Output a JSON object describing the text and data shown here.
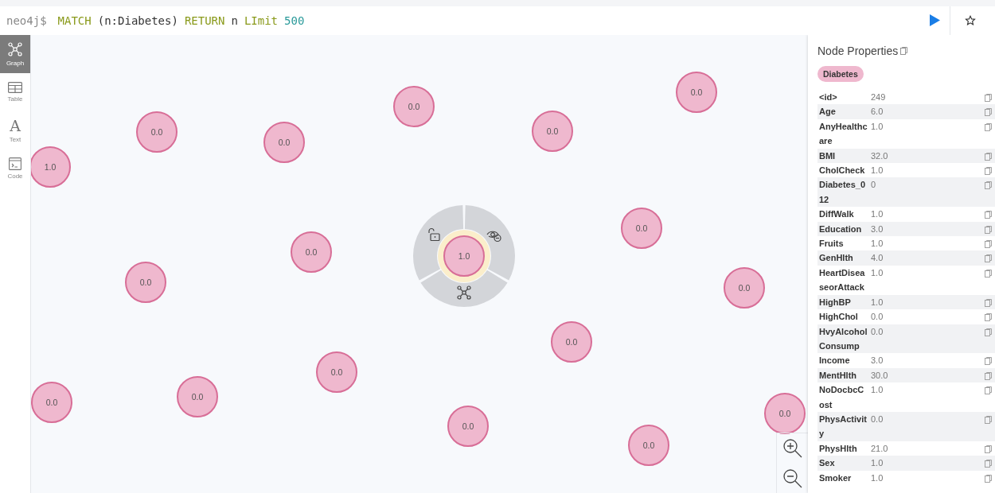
{
  "query": {
    "prompt": "neo4j$",
    "tokens": [
      {
        "text": "MATCH",
        "kind": "keyword"
      },
      {
        "text": "(n:Diabetes)",
        "kind": "plain"
      },
      {
        "text": "RETURN",
        "kind": "keyword"
      },
      {
        "text": "n",
        "kind": "plain"
      },
      {
        "text": "LImit",
        "kind": "keyword"
      },
      {
        "text": "500",
        "kind": "number"
      }
    ]
  },
  "sidebar": {
    "items": [
      {
        "label": "Graph",
        "kind": "graph",
        "selected": true
      },
      {
        "label": "Table",
        "kind": "table",
        "selected": false
      },
      {
        "label": "Text",
        "kind": "text",
        "glyph": "A",
        "selected": false
      },
      {
        "label": "Code",
        "kind": "code",
        "selected": false
      }
    ]
  },
  "graph": {
    "nodes": [
      {
        "caption": "1.0",
        "selected": false
      },
      {
        "caption": "0.0",
        "selected": false
      },
      {
        "caption": "0.0",
        "selected": false
      },
      {
        "caption": "0.0",
        "selected": false
      },
      {
        "caption": "0.0",
        "selected": false
      },
      {
        "caption": "0.0",
        "selected": false
      },
      {
        "caption": "0.0",
        "selected": false
      },
      {
        "caption": "0.0",
        "selected": false
      },
      {
        "caption": "0.0",
        "selected": false
      },
      {
        "caption": "1.0",
        "selected": true
      },
      {
        "caption": "0.0",
        "selected": false
      },
      {
        "caption": "0.0",
        "selected": false
      },
      {
        "caption": "0.0",
        "selected": false
      },
      {
        "caption": "0.0",
        "selected": false
      },
      {
        "caption": "0.0",
        "selected": false
      },
      {
        "caption": "0.0",
        "selected": false
      },
      {
        "caption": "0.0",
        "selected": false
      },
      {
        "caption": "0.0",
        "selected": false
      }
    ]
  },
  "node_properties": {
    "title": "Node Properties",
    "labels": [
      "Diabetes"
    ],
    "properties": [
      {
        "key": "<id>",
        "value": "249"
      },
      {
        "key": "Age",
        "value": "6.0"
      },
      {
        "key": "AnyHealthcare",
        "value": "1.0"
      },
      {
        "key": "BMI",
        "value": "32.0"
      },
      {
        "key": "CholCheck",
        "value": "1.0"
      },
      {
        "key": "Diabetes_012",
        "value": "0"
      },
      {
        "key": "DiffWalk",
        "value": "1.0"
      },
      {
        "key": "Education",
        "value": "3.0"
      },
      {
        "key": "Fruits",
        "value": "1.0"
      },
      {
        "key": "GenHlth",
        "value": "4.0"
      },
      {
        "key": "HeartDiseaseorAttack",
        "value": "1.0"
      },
      {
        "key": "HighBP",
        "value": "1.0"
      },
      {
        "key": "HighChol",
        "value": "0.0"
      },
      {
        "key": "HvyAlcoholConsump",
        "value": "0.0"
      },
      {
        "key": "Income",
        "value": "3.0"
      },
      {
        "key": "MentHlth",
        "value": "30.0"
      },
      {
        "key": "NoDocbcCost",
        "value": "1.0"
      },
      {
        "key": "PhysActivity",
        "value": "0.0"
      },
      {
        "key": "PhysHlth",
        "value": "21.0"
      },
      {
        "key": "Sex",
        "value": "1.0"
      },
      {
        "key": "Smoker",
        "value": "1.0"
      }
    ]
  }
}
